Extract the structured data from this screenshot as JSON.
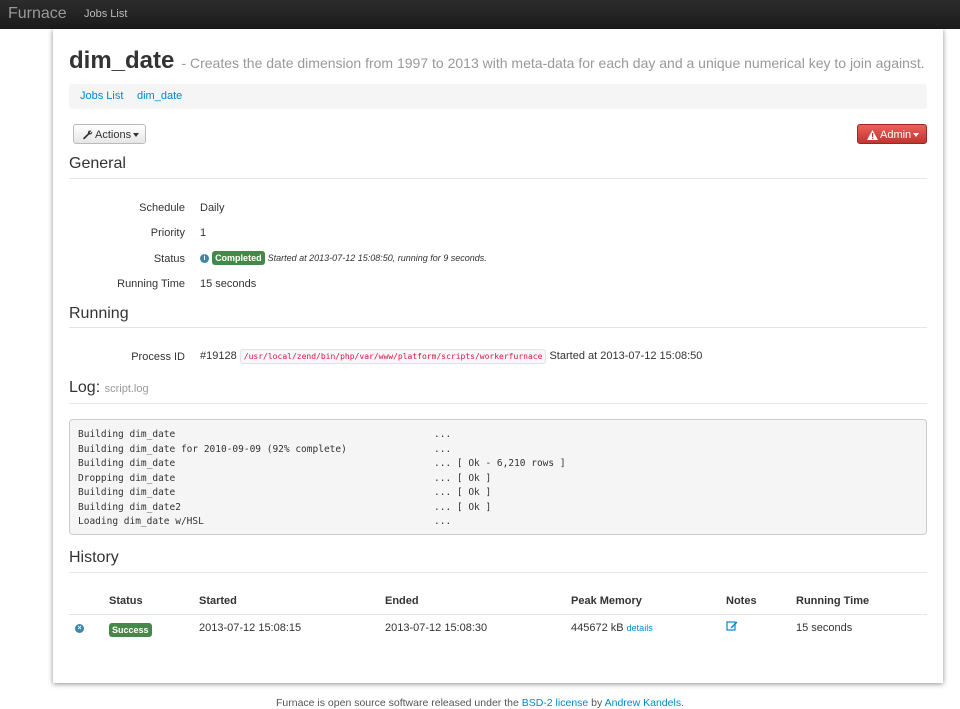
{
  "navbar": {
    "brand": "Furnace",
    "jobs_list": "Jobs List"
  },
  "header": {
    "title": "dim_date",
    "description": "- Creates the date dimension from 1997 to 2013 with meta-data for each day and a unique numerical key to join against."
  },
  "breadcrumb": {
    "items": [
      "Jobs List",
      "dim_date"
    ],
    "separator": "/"
  },
  "actions": {
    "actions_label": "Actions",
    "admin_label": "Admin"
  },
  "general": {
    "title": "General",
    "schedule_label": "Schedule",
    "schedule_value": "Daily",
    "priority_label": "Priority",
    "priority_value": "1",
    "status_label": "Status",
    "status_badge": "Completed",
    "status_note": "Started at 2013-07-12 15:08:50, running for 9 seconds.",
    "running_time_label": "Running Time",
    "running_time_value": "15 seconds"
  },
  "running": {
    "title": "Running",
    "process_label": "Process ID",
    "process_id": "#19128",
    "process_path": "/usr/local/zend/bin/php/var/www/platform/scripts/workerfurnace",
    "process_started": "Started at 2013-07-12 15:08:50"
  },
  "log": {
    "title": "Log:",
    "file": "script.log",
    "lines": [
      {
        "left": "Building dim_date",
        "right": "..."
      },
      {
        "left": "Building dim_date for 2010-09-09 (92% complete)",
        "right": "..."
      },
      {
        "left": "Building dim_date",
        "right": "... [ Ok - 6,210 rows ]"
      },
      {
        "left": "Dropping dim_date",
        "right": "... [ Ok ]"
      },
      {
        "left": "Building dim_date",
        "right": "... [ Ok ]"
      },
      {
        "left": "Building dim_date2",
        "right": "... [ Ok ]"
      },
      {
        "left": "Loading dim_date w/HSL",
        "right": "..."
      }
    ]
  },
  "history": {
    "title": "History",
    "columns": [
      "Status",
      "Started",
      "Ended",
      "Peak Memory",
      "Notes",
      "Running Time"
    ],
    "rows": [
      {
        "status": "Success",
        "started": "2013-07-12 15:08:15",
        "ended": "2013-07-12 15:08:30",
        "peak_memory": "445672 kB",
        "details": "details",
        "running_time": "15 seconds"
      }
    ]
  },
  "footer": {
    "prefix": "Furnace is open source software released under the",
    "license": "BSD-2 license",
    "by": "by",
    "author": "Andrew Kandels",
    "suffix": "."
  },
  "colors": {
    "navbar": "#1b1b1b",
    "link": "#0088cc",
    "success": "#468847",
    "danger": "#bd362f",
    "info": "#3a87ad",
    "code": "#dd1144"
  }
}
